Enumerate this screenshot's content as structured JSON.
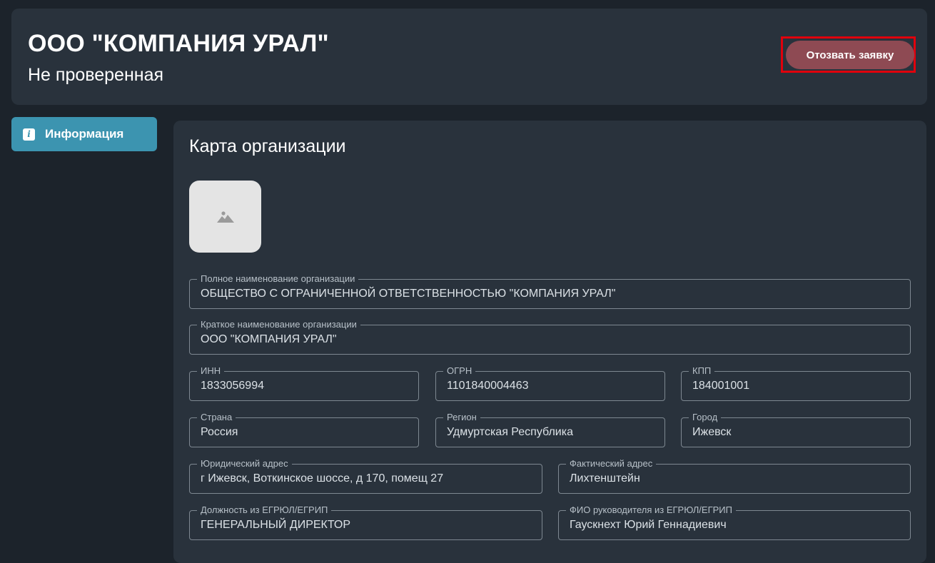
{
  "header": {
    "title": "ООО \"КОМПАНИЯ УРАЛ\"",
    "status": "Не проверенная",
    "withdraw_label": "Отозвать заявку"
  },
  "sidebar": {
    "items": [
      {
        "label": "Информация",
        "icon": "info-icon",
        "active": true
      }
    ]
  },
  "card": {
    "title": "Карта организации",
    "logo_icon": "image-placeholder-icon",
    "fields": {
      "full_name": {
        "label": "Полное наименование организации",
        "value": "ОБЩЕСТВО С ОГРАНИЧЕННОЙ ОТВЕТСТВЕННОСТЬЮ \"КОМПАНИЯ УРАЛ\""
      },
      "short_name": {
        "label": "Краткое наименование организации",
        "value": "ООО \"КОМПАНИЯ УРАЛ\""
      },
      "inn": {
        "label": "ИНН",
        "value": "1833056994"
      },
      "ogrn": {
        "label": "ОГРН",
        "value": "1101840004463"
      },
      "kpp": {
        "label": "КПП",
        "value": "184001001"
      },
      "country": {
        "label": "Страна",
        "value": "Россия"
      },
      "region": {
        "label": "Регион",
        "value": "Удмуртская Республика"
      },
      "city": {
        "label": "Город",
        "value": "Ижевск"
      },
      "legal_address": {
        "label": "Юридический адрес",
        "value": "г Ижевск, Воткинское шоссе, д 170, помещ 27"
      },
      "actual_address": {
        "label": "Фактический адрес",
        "value": "Лихтенштейн"
      },
      "position": {
        "label": "Должность из ЕГРЮЛ/ЕГРИП",
        "value": "ГЕНЕРАЛЬНЫЙ ДИРЕКТОР"
      },
      "head_name": {
        "label": "ФИО руководителя из ЕГРЮЛ/ЕГРИП",
        "value": "Гаускнехт Юрий Геннадиевич"
      }
    }
  },
  "colors": {
    "background": "#1c232b",
    "panel": "#29323c",
    "accent": "#3c94b0",
    "withdraw_button": "#8e4a53",
    "highlight": "#e0000c"
  }
}
